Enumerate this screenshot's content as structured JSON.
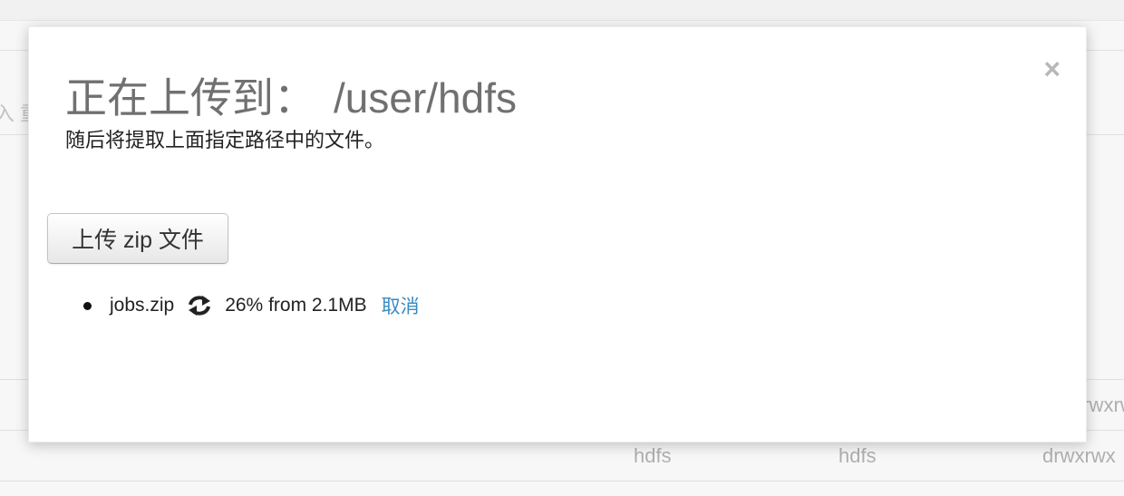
{
  "background": {
    "left_fragment": "入 重",
    "row1": {
      "permissions": "drwxrwx"
    },
    "row2": {
      "owner": "hdfs",
      "group": "hdfs",
      "permissions": "drwxrwx"
    }
  },
  "modal": {
    "title_prefix": "正在上传到：",
    "title_path": "/user/hdfs",
    "subtitle": "随后将提取上面指定路径中的文件。",
    "upload_button": "上传 zip 文件",
    "close_symbol": "×",
    "uploads": [
      {
        "file_name": "jobs.zip",
        "progress_text": "26% from 2.1MB",
        "cancel_label": "取消"
      }
    ]
  },
  "colors": {
    "link": "#3a8bc4",
    "title": "#707070"
  }
}
